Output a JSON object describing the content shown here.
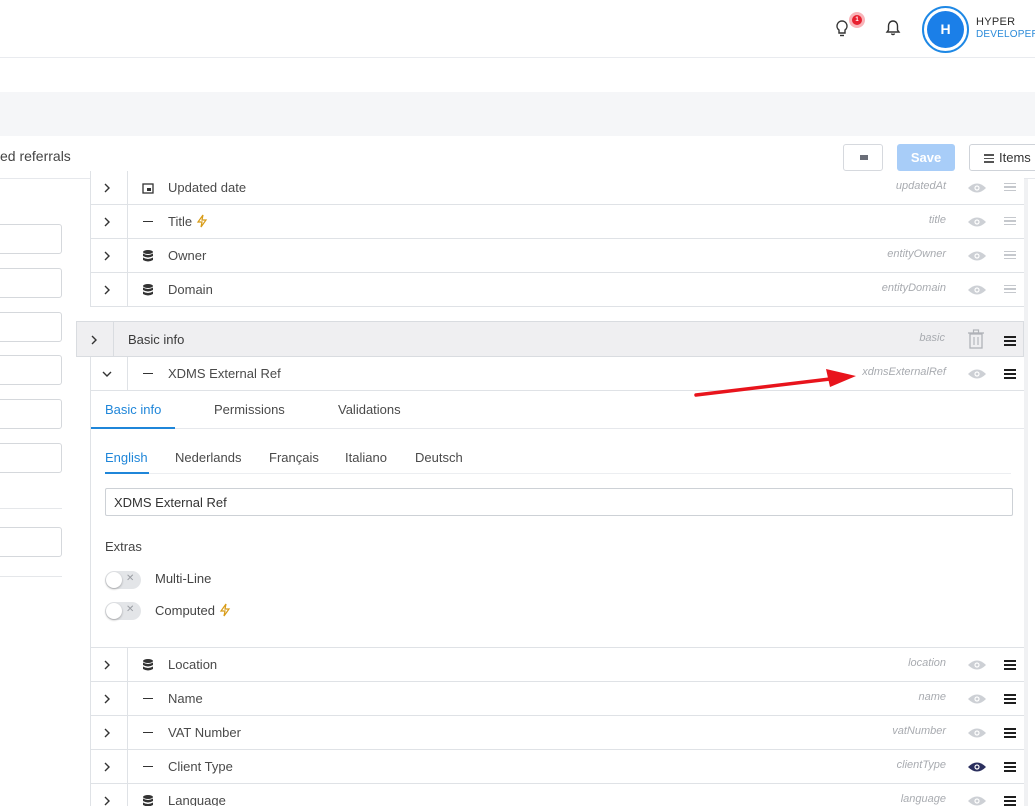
{
  "topbar": {
    "notifications_count": "1",
    "avatar_initial": "H",
    "org_name": "HYPER",
    "org_sub": "DEVELOPERS"
  },
  "header": {
    "title": "ed referrals",
    "save_label": "Save",
    "items_label": "Items"
  },
  "fields_top": [
    {
      "name": "Updated date",
      "key": "updatedAt",
      "icon": "calendar-icon"
    },
    {
      "name": "Title",
      "key": "title",
      "icon": "dash-icon",
      "computed": true
    },
    {
      "name": "Owner",
      "key": "entityOwner",
      "icon": "database-icon"
    },
    {
      "name": "Domain",
      "key": "entityDomain",
      "icon": "database-icon"
    }
  ],
  "group": {
    "name": "Basic info",
    "key": "basic"
  },
  "expanded_field": {
    "name": "XDMS External Ref",
    "key": "xdmsExternalRef",
    "icon": "dash-icon"
  },
  "panel": {
    "tabs": [
      "Basic info",
      "Permissions",
      "Validations"
    ],
    "active_tab": "Basic info",
    "languages": [
      "English",
      "Nederlands",
      "Français",
      "Italiano",
      "Deutsch"
    ],
    "active_language": "English",
    "label_value": "XDMS External Ref",
    "extras_heading": "Extras",
    "toggles": [
      {
        "label": "Multi-Line",
        "on": false
      },
      {
        "label": "Computed",
        "on": false
      }
    ]
  },
  "fields_bottom": [
    {
      "name": "Location",
      "key": "location",
      "icon": "database-icon"
    },
    {
      "name": "Name",
      "key": "name",
      "icon": "dash-icon"
    },
    {
      "name": "VAT Number",
      "key": "vatNumber",
      "icon": "dash-icon"
    },
    {
      "name": "Client Type",
      "key": "clientType",
      "icon": "dash-icon",
      "visible": true
    },
    {
      "name": "Language",
      "key": "language",
      "icon": "database-icon"
    }
  ],
  "colors": {
    "accent": "#1f86d9",
    "annotation_arrow": "#e8141c",
    "bolt": "#e0a21a"
  }
}
